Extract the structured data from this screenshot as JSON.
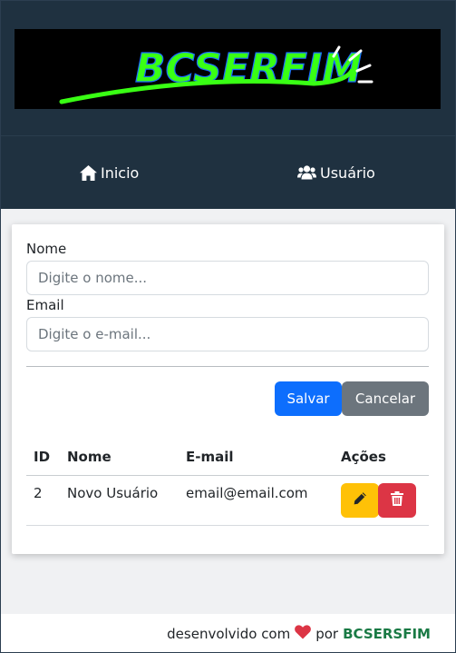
{
  "header": {
    "logo_text": "BCSERFIM",
    "logo_colors": {
      "text": "#39ff14",
      "underline": "#39ff14",
      "rays": "#ffffff",
      "background": "#000000"
    }
  },
  "nav": {
    "items": [
      {
        "label": "Inicio",
        "icon": "home-icon"
      },
      {
        "label": "Usuário",
        "icon": "users-icon"
      }
    ]
  },
  "form": {
    "name_label": "Nome",
    "name_placeholder": "Digite o nome...",
    "name_value": "",
    "email_label": "Email",
    "email_placeholder": "Digite o e-mail...",
    "email_value": "",
    "save_label": "Salvar",
    "cancel_label": "Cancelar"
  },
  "table": {
    "columns": [
      "ID",
      "Nome",
      "E-mail",
      "Ações"
    ],
    "rows": [
      {
        "id": "2",
        "nome": "Novo Usuário",
        "email": "email@email.com",
        "actions": [
          "pencil-icon",
          "trash-icon"
        ]
      }
    ]
  },
  "footer": {
    "prefix": "desenvolvido com",
    "heart_icon": "heart-icon",
    "middle": "por",
    "brand": "BCSERSFIM",
    "brand_color": "#1a7a45"
  },
  "colors": {
    "primary": "#0d6efd",
    "secondary": "#6c757d",
    "warning": "#ffc107",
    "danger": "#dc3545",
    "header_bg": "#1f3140"
  }
}
